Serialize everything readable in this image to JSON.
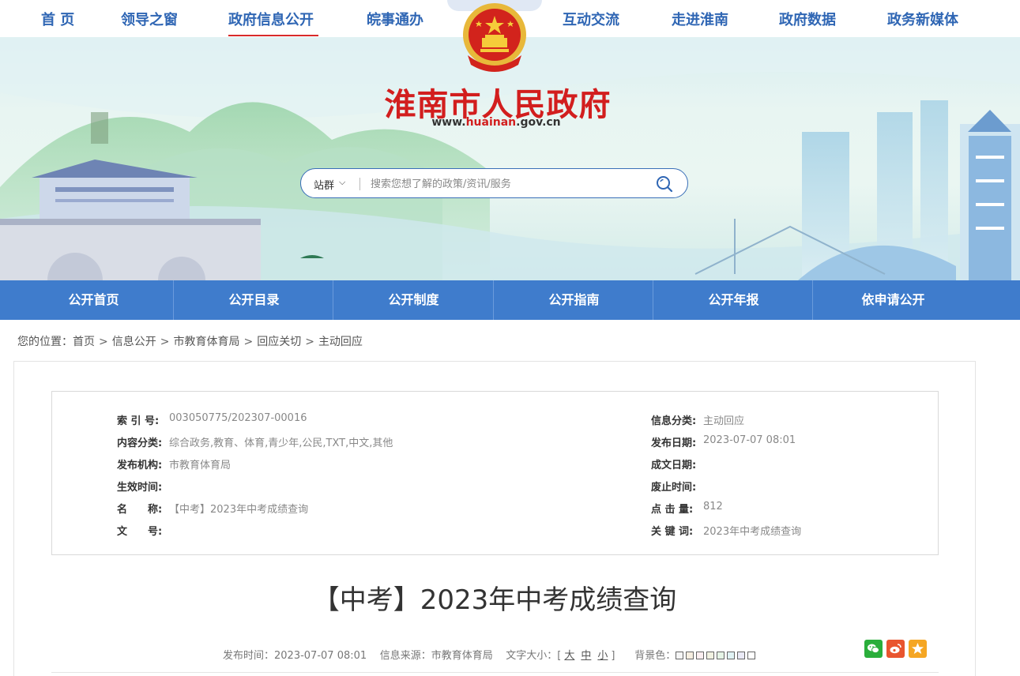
{
  "topnav": {
    "items": [
      "首 页",
      "领导之窗",
      "政府信息公开",
      "皖事通办",
      "互动交流",
      "走进淮南",
      "政府数据",
      "政务新媒体"
    ],
    "active_index": 2,
    "accent_color": "#2f66b4",
    "active_underline_color": "#d92a2a"
  },
  "banner": {
    "site_title": "淮南市人民政府",
    "site_url_parts": [
      "www.",
      "huainan",
      ".gov.cn"
    ],
    "title_color": "#d21e1e",
    "emblem_icon": "national-emblem-icon"
  },
  "search": {
    "scope_label": "站群",
    "placeholder": "搜索您想了解的政策/资讯/服务"
  },
  "subnav": {
    "items": [
      "公开首页",
      "公开目录",
      "公开制度",
      "公开指南",
      "公开年报",
      "依申请公开"
    ],
    "bg_color": "#3f7ccc"
  },
  "breadcrumb": {
    "prefix": "您的位置：",
    "items": [
      "首页",
      "信息公开",
      "市教育体育局",
      "回应关切",
      "主动回应"
    ],
    "separator": ">"
  },
  "meta": {
    "left": [
      {
        "label": "索 引 号:",
        "value": "003050775/202307-00016"
      },
      {
        "label": "内容分类:",
        "value": "综合政务,教育、体育,青少年,公民,TXT,中文,其他"
      },
      {
        "label": "发布机构:",
        "value": "市教育体育局"
      },
      {
        "label": "生效时间:",
        "value": ""
      },
      {
        "label": "名　　称:",
        "value": "【中考】2023年中考成绩查询"
      },
      {
        "label": "文　　号:",
        "value": ""
      }
    ],
    "right": [
      {
        "label": "信息分类:",
        "value": "主动回应"
      },
      {
        "label": "发布日期:",
        "value": "2023-07-07 08:01"
      },
      {
        "label": "成文日期:",
        "value": ""
      },
      {
        "label": "废止时间:",
        "value": ""
      },
      {
        "label": "点 击 量:",
        "value": "812"
      },
      {
        "label": "关 键 词:",
        "value": "2023年中考成绩查询"
      }
    ]
  },
  "article": {
    "title": "【中考】2023年中考成绩查询",
    "publish_label": "发布时间：",
    "publish_time": "2023-07-07 08:01",
    "source_label": "信息来源：",
    "source": "市教育体育局",
    "fontsize_label": "文字大小：[",
    "fontsize_options": [
      "大",
      "中",
      "小"
    ],
    "fontsize_close": "]",
    "bg_label": "背景色：",
    "bg_colors": [
      "#f5f5f5",
      "#f6eee0",
      "#fbeef0",
      "#f1f1e1",
      "#e6f4e6",
      "#e0f2f4",
      "#eaeaf6",
      "#ffffff"
    ]
  },
  "share": {
    "icons": [
      "wechat-icon",
      "weibo-icon",
      "favorite-star-icon"
    ],
    "colors": [
      "#2aae3b",
      "#e9552f",
      "#f5a623"
    ]
  }
}
